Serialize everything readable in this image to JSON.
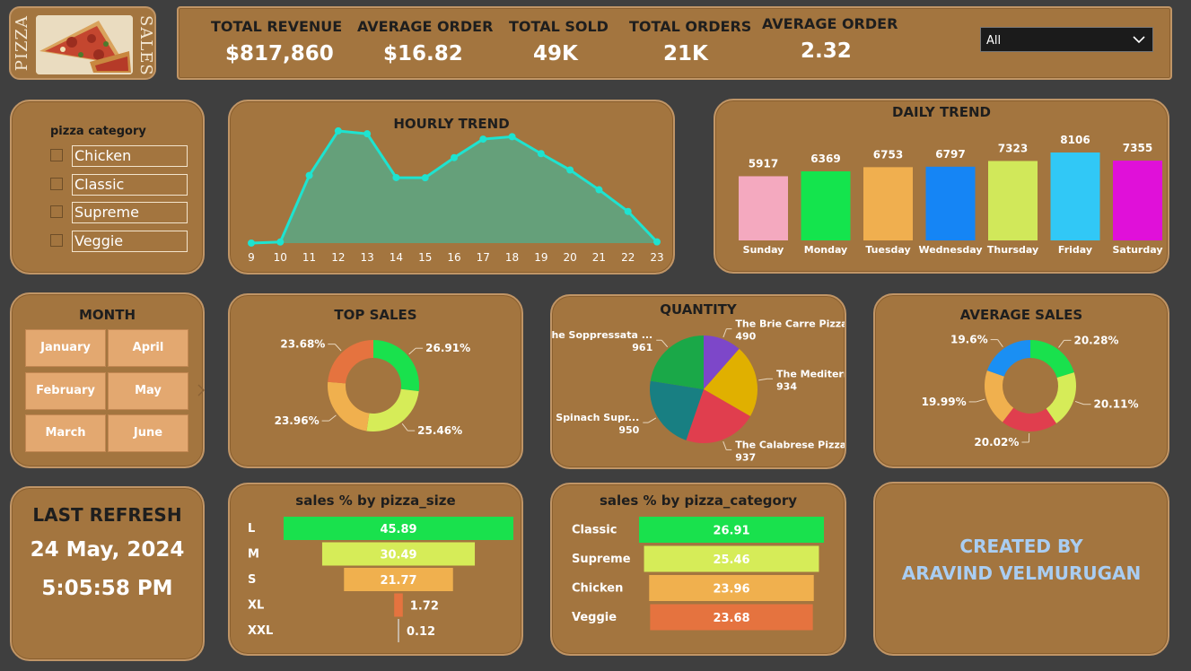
{
  "logo": {
    "left_word": "PIZZA",
    "right_word": "SALES"
  },
  "kpis": [
    {
      "label": "TOTAL REVENUE",
      "value": "$817,860"
    },
    {
      "label": "AVERAGE ORDER",
      "value": "$16.82"
    },
    {
      "label": "TOTAL SOLD",
      "value": "49K"
    },
    {
      "label": "TOTAL ORDERS",
      "value": "21K"
    },
    {
      "label": "AVERAGE ORDER",
      "value": "2.32"
    }
  ],
  "filter_dropdown": {
    "selected": "All"
  },
  "category_slicer": {
    "title": "pizza category",
    "items": [
      "Chicken",
      "Classic",
      "Supreme",
      "Veggie"
    ]
  },
  "month_slicer": {
    "title": "MONTH",
    "items": [
      "January",
      "April",
      "February",
      "May",
      "March",
      "June"
    ]
  },
  "last_refresh": {
    "title": "LAST REFRESH",
    "date": "24 May, 2024",
    "time": "5:05:58 PM"
  },
  "credit": {
    "line1": "CREATED BY",
    "line2": "ARAVIND VELMURUGAN"
  },
  "colors": {
    "card": "#a3753f",
    "area_fill": "#65a07a",
    "area_line": "#1ee3d0",
    "credit_text": "#a9cdf2"
  },
  "chart_data": [
    {
      "id": "hourly",
      "type": "area",
      "title": "HOURLY TREND",
      "x": [
        9,
        10,
        11,
        12,
        13,
        14,
        15,
        16,
        17,
        18,
        19,
        20,
        21,
        22,
        23
      ],
      "values": [
        1,
        24,
        1520,
        2520,
        2455,
        1472,
        1468,
        1920,
        2336,
        2390,
        2010,
        1642,
        1198,
        711,
        28
      ],
      "ylim": [
        0,
        2700
      ]
    },
    {
      "id": "daily",
      "type": "bar",
      "title": "DAILY TREND",
      "categories": [
        "Sunday",
        "Monday",
        "Tuesday",
        "Wednesday",
        "Thursday",
        "Friday",
        "Saturday"
      ],
      "values": [
        5917,
        6369,
        6753,
        6797,
        7323,
        8106,
        7355
      ],
      "colors": [
        "#f4a9bf",
        "#14e44d",
        "#f0af4f",
        "#1585f5",
        "#d1e85a",
        "#31c8f6",
        "#e010d9"
      ]
    },
    {
      "id": "top_sales",
      "type": "pie",
      "title": "TOP SALES",
      "labels": [
        "26.91%",
        "25.46%",
        "23.96%",
        "23.68%"
      ],
      "values": [
        26.91,
        25.46,
        23.96,
        23.68
      ],
      "colors": [
        "#19e14d",
        "#d6ec58",
        "#f0b04e",
        "#e5733f"
      ]
    },
    {
      "id": "quantity",
      "type": "pie",
      "title": "QUANTITY",
      "labels": [
        "The Brie Carre Pizza",
        "The Mediterra...",
        "The Calabrese Pizza",
        "The Spinach Supr...",
        "The Soppressata ..."
      ],
      "values": [
        490,
        934,
        937,
        950,
        961
      ],
      "colors": [
        "#7d47c9",
        "#e0b000",
        "#e03e4e",
        "#187f82",
        "#1aa848"
      ]
    },
    {
      "id": "avg_sales",
      "type": "pie",
      "title": "AVERAGE SALES",
      "labels": [
        "20.28%",
        "20.11%",
        "20.02%",
        "19.99%",
        "19.6%"
      ],
      "values": [
        20.28,
        20.11,
        20.02,
        19.99,
        19.6
      ],
      "colors": [
        "#19e14d",
        "#d6ec58",
        "#e03e4e",
        "#f0b04e",
        "#1a8ff3"
      ]
    },
    {
      "id": "size",
      "type": "bar",
      "title": "sales % by pizza_size",
      "categories": [
        "L",
        "M",
        "S",
        "XL",
        "XXL"
      ],
      "values": [
        45.89,
        30.49,
        21.77,
        1.72,
        0.12
      ],
      "colors": [
        "#19e14d",
        "#d6ec58",
        "#f0b04e",
        "#e5733f",
        "#c6b6a4"
      ]
    },
    {
      "id": "category",
      "type": "bar",
      "title": "sales % by pizza_category",
      "categories": [
        "Classic",
        "Supreme",
        "Chicken",
        "Veggie"
      ],
      "values": [
        26.91,
        25.46,
        23.96,
        23.68
      ],
      "colors": [
        "#19e14d",
        "#d6ec58",
        "#f0b04e",
        "#e5733f"
      ]
    }
  ]
}
